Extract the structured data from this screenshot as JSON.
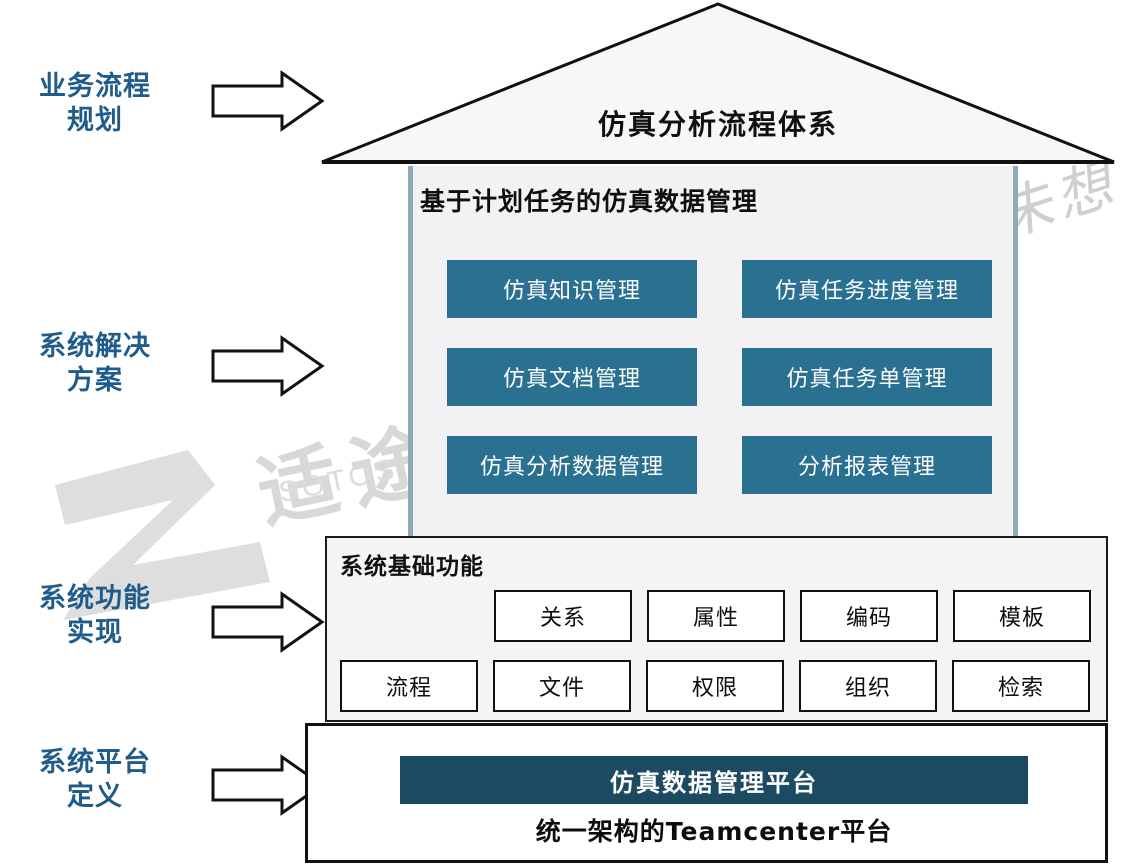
{
  "roof": {
    "title": "仿真分析流程体系"
  },
  "body_panel": {
    "title": "基于计划任务的仿真数据管理",
    "modules": [
      "仿真知识管理",
      "仿真任务进度管理",
      "仿真文档管理",
      "仿真任务单管理",
      "仿真分析数据管理",
      "分析报表管理"
    ]
  },
  "base_panel": {
    "title": "系统基础功能",
    "row1": [
      "关系",
      "属性",
      "编码",
      "模板"
    ],
    "row2": [
      "流程",
      "文件",
      "权限",
      "组织",
      "检索"
    ]
  },
  "platform": {
    "bar_label": "仿真数据管理平台",
    "sub_label": "统一架构的Teamcenter平台"
  },
  "stages": [
    {
      "line1": "业务流程",
      "line2": "规划"
    },
    {
      "line1": "系统解决",
      "line2": "方案"
    },
    {
      "line1": "系统功能",
      "line2": "实现"
    },
    {
      "line1": "系统平台",
      "line2": "定义"
    }
  ],
  "watermark": {
    "cn": "适途科技",
    "en": "SOTOS TECHNOLOGY",
    "hand": "创想未想"
  },
  "colors": {
    "label_blue": "#1f5c8b",
    "teal": "#2a7191",
    "dark_teal": "#1c4a62",
    "panel_gray": "#f2f1f3",
    "pillar_gray": "#8fa9b5",
    "outline": "#111111"
  }
}
